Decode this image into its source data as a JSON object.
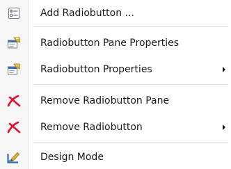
{
  "menu": {
    "items": [
      {
        "label": "Add Radiobutton ...",
        "icon": "radiobutton-list-icon",
        "submenu": false
      },
      {
        "label": "Radiobutton Pane Properties",
        "icon": "properties-icon",
        "submenu": false
      },
      {
        "label": "Radiobutton Properties",
        "icon": "properties-icon",
        "submenu": true
      },
      {
        "label": "Remove Radiobutton Pane",
        "icon": "remove-icon",
        "submenu": false
      },
      {
        "label": "Remove Radiobutton",
        "icon": "remove-icon",
        "submenu": true
      },
      {
        "label": "Design Mode",
        "icon": "design-mode-icon",
        "submenu": false
      }
    ]
  },
  "colors": {
    "remove_red": "#e0102a",
    "icon_blue": "#2f6fc0",
    "icon_gold": "#e2b43a"
  }
}
